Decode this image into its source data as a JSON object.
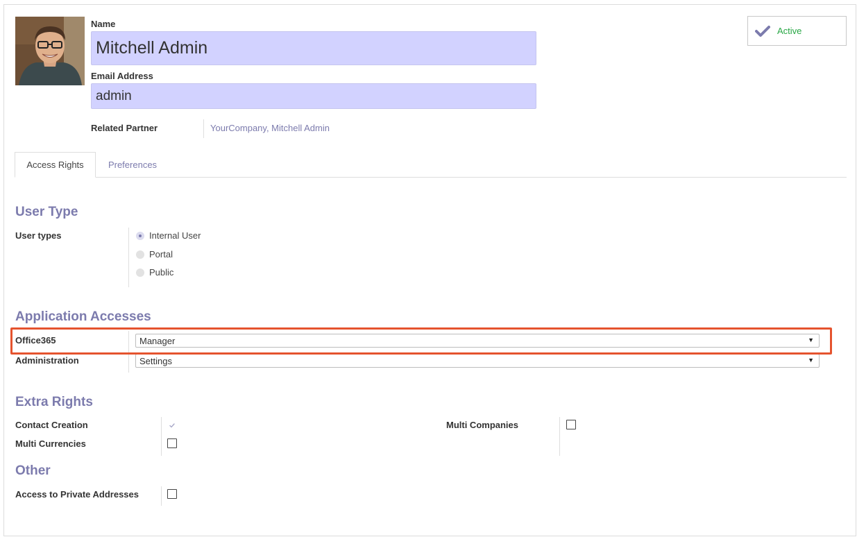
{
  "header": {
    "name_label": "Name",
    "name_value": "Mitchell Admin",
    "email_label": "Email Address",
    "email_value": "admin",
    "related_partner_label": "Related Partner",
    "related_partner_value": "YourCompany, Mitchell Admin",
    "active_label": "Active"
  },
  "tabs": [
    {
      "label": "Access Rights",
      "active": true
    },
    {
      "label": "Preferences",
      "active": false
    }
  ],
  "user_type": {
    "title": "User Type",
    "field_label": "User types",
    "options": [
      {
        "label": "Internal User",
        "selected": true
      },
      {
        "label": "Portal",
        "selected": false
      },
      {
        "label": "Public",
        "selected": false
      }
    ]
  },
  "app_access": {
    "title": "Application Accesses",
    "rows": [
      {
        "label": "Office365",
        "value": "Manager"
      },
      {
        "label": "Administration",
        "value": "Settings"
      }
    ]
  },
  "extra_rights": {
    "title": "Extra Rights",
    "contact_creation": {
      "label": "Contact Creation",
      "checked": true
    },
    "multi_currencies": {
      "label": "Multi Currencies",
      "checked": false
    },
    "multi_companies": {
      "label": "Multi Companies",
      "checked": false
    }
  },
  "other": {
    "title": "Other",
    "private_addresses": {
      "label": "Access to Private Addresses",
      "checked": false
    }
  },
  "colors": {
    "accent": "#7c7bad",
    "input_bg": "#d2d2ff",
    "active_green": "#28a745",
    "highlight": "#e5532e"
  }
}
